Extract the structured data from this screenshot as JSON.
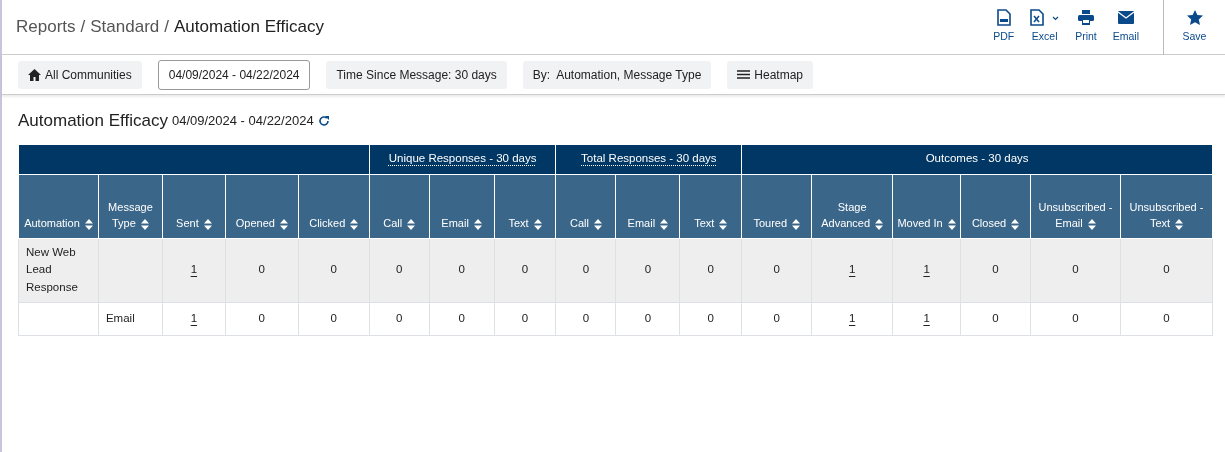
{
  "breadcrumb": {
    "parts": [
      "Reports",
      "Standard"
    ],
    "separator": "/",
    "current": "Automation Efficacy"
  },
  "actions": [
    {
      "label": "PDF",
      "kind": "pdf"
    },
    {
      "label": "Excel",
      "kind": "excel"
    },
    {
      "label": "Print",
      "kind": "print"
    },
    {
      "label": "Email",
      "kind": "email"
    }
  ],
  "save": {
    "label": "Save"
  },
  "filters": [
    {
      "label": "All Communities",
      "kind": "home"
    },
    {
      "label": "04/09/2024 - 04/22/2024",
      "kind": "date"
    },
    {
      "label": "Time Since Message: 30 days",
      "kind": "plain"
    },
    {
      "label": "By:  Automation, Message Type",
      "kind": "plain"
    },
    {
      "label": "Heatmap",
      "kind": "heatmap"
    }
  ],
  "report": {
    "title": "Automation Efficacy",
    "range": "04/09/2024 - 04/22/2024"
  },
  "table": {
    "groups": [
      {
        "columns": [
          "Automation",
          "Message Type",
          "Sent",
          "Opened",
          "Clicked"
        ]
      },
      {
        "label": "Unique Responses - 30 days",
        "tooltip": true,
        "columns": [
          "Call",
          "Email",
          "Text"
        ]
      },
      {
        "label": "Total Responses - 30 days",
        "tooltip": true,
        "columns": [
          "Call",
          "Email",
          "Text"
        ]
      },
      {
        "label": "Outcomes - 30 days",
        "tooltip": false,
        "columns": [
          "Toured",
          "Stage Advanced",
          "Moved In",
          "Closed",
          "Unsubscribed - Email",
          "Unsubscribed - Text"
        ]
      }
    ],
    "rows": [
      {
        "kind": "group",
        "cells": [
          "New Web Lead Response",
          "",
          {
            "text": "1",
            "kind": "link"
          },
          "0",
          "0",
          "0",
          "0",
          "0",
          "0",
          "0",
          "0",
          "0",
          {
            "text": "1",
            "kind": "link"
          },
          {
            "text": "1",
            "kind": "link"
          },
          "0",
          "0",
          "0"
        ]
      },
      {
        "kind": "detail",
        "cells": [
          "",
          "Email",
          {
            "text": "1",
            "kind": "link"
          },
          "0",
          "0",
          "0",
          "0",
          "0",
          "0",
          "0",
          "0",
          "0",
          {
            "text": "1",
            "kind": "link"
          },
          {
            "text": "1",
            "kind": "link"
          },
          "0",
          "0",
          "0"
        ]
      }
    ]
  }
}
